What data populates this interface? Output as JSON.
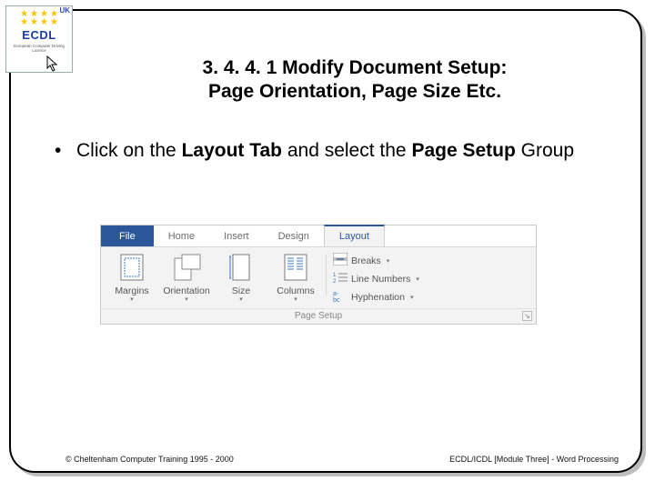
{
  "logo": {
    "uk": "UK",
    "brand": "ECDL",
    "tagline": "European Computer Driving Licence"
  },
  "title": {
    "line1": "3. 4. 4. 1 Modify Document Setup:",
    "line2": "Page Orientation, Page Size Etc."
  },
  "bullet": {
    "t1": "Click on the ",
    "b1": "Layout Tab ",
    "t2": "and select the ",
    "b2": "Page Setup ",
    "t3": "Group"
  },
  "ribbon": {
    "tabs": {
      "file": "File",
      "home": "Home",
      "insert": "Insert",
      "design": "Design",
      "layout": "Layout"
    },
    "big": {
      "margins": "Margins",
      "orientation": "Orientation",
      "size": "Size",
      "columns": "Columns"
    },
    "small": {
      "breaks": "Breaks",
      "linenumbers": "Line Numbers",
      "hyphenation": "Hyphenation"
    },
    "group": "Page Setup",
    "chev": "▾",
    "launcher": "↘"
  },
  "footer": {
    "left": "© Cheltenham Computer Training 1995 - 2000",
    "right": "ECDL/ICDL [Module Three]  - Word Processing"
  }
}
